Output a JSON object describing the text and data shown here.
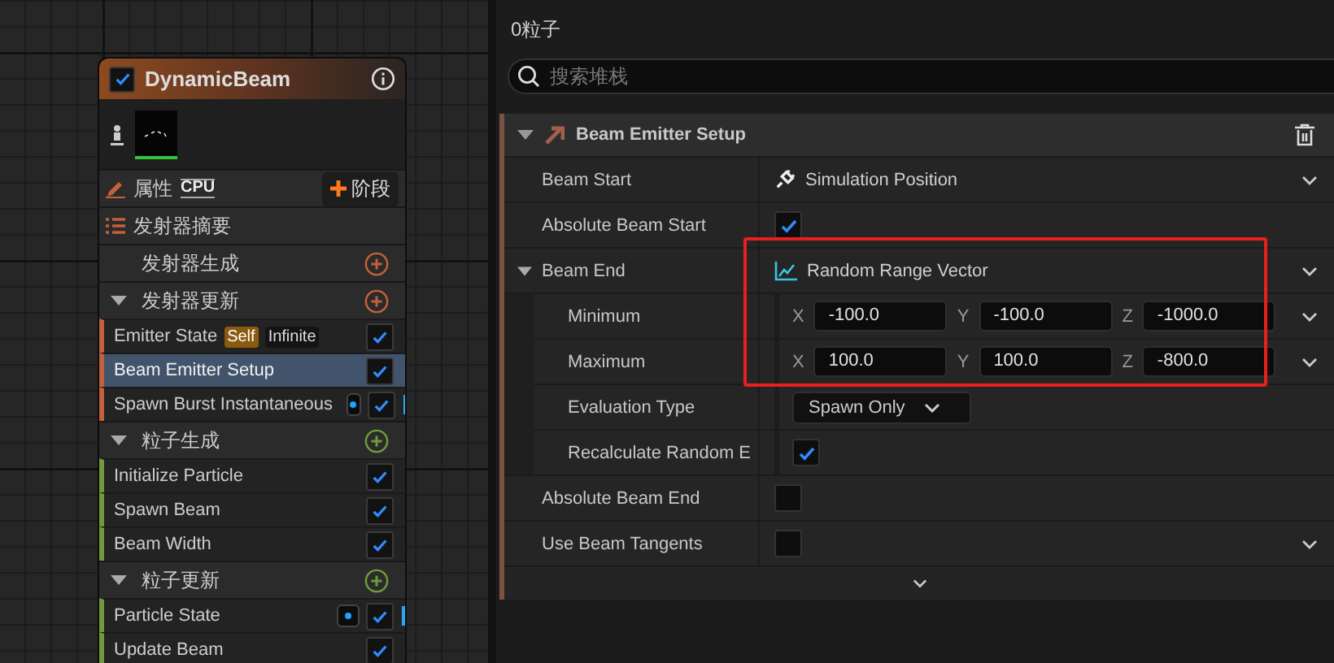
{
  "node": {
    "title": "DynamicBeam",
    "enabled": true,
    "properties_label": "属性",
    "sim_target": "CPU",
    "add_stage": "阶段",
    "summary": "发射器摘要",
    "groups": [
      {
        "title": "发射器生成",
        "color": "#c2613c"
      },
      {
        "title": "发射器更新",
        "color": "#c2613c",
        "modules": [
          {
            "label": "Emitter State",
            "enabled": true,
            "selected": false,
            "indicator": false,
            "badges": [
              {
                "text": "Self",
                "kind": "owner"
              },
              {
                "text": "Infinite",
                "kind": "plain"
              }
            ]
          },
          {
            "label": "Beam Emitter Setup",
            "enabled": true,
            "selected": true,
            "indicator": false
          },
          {
            "label": "Spawn Burst Instantaneous",
            "enabled": true,
            "selected": false,
            "indicator": true
          }
        ]
      },
      {
        "title": "粒子生成",
        "color": "#6f9b3c",
        "modules": [
          {
            "label": "Initialize Particle",
            "enabled": true,
            "selected": false,
            "indicator": false
          },
          {
            "label": "Spawn Beam",
            "enabled": true,
            "selected": false,
            "indicator": false
          },
          {
            "label": "Beam Width",
            "enabled": true,
            "selected": false,
            "indicator": false
          }
        ]
      },
      {
        "title": "粒子更新",
        "color": "#6f9b3c",
        "modules": [
          {
            "label": "Particle State",
            "enabled": true,
            "selected": false,
            "indicator": true
          },
          {
            "label": "Update Beam",
            "enabled": true,
            "selected": false,
            "indicator": false
          }
        ]
      }
    ]
  },
  "panel": {
    "particle_count": "0粒子",
    "search": {
      "placeholder": "搜索堆栈"
    },
    "section": {
      "title": "Beam Emitter Setup",
      "expanded": true,
      "rows": [
        {
          "label": "Beam Start",
          "kind": "link",
          "value": "Simulation Position",
          "menu": true,
          "highlighted": false
        },
        {
          "label": "Absolute Beam Start",
          "kind": "checkbox",
          "checked": true,
          "menu": false,
          "highlighted": false
        },
        {
          "label": "Beam End",
          "kind": "function",
          "value": "Random Range Vector",
          "menu": true,
          "highlighted": true,
          "expanded": true,
          "children": [
            {
              "label": "Minimum",
              "kind": "vector",
              "menu": true,
              "components": [
                {
                  "axis": "X",
                  "value": "-100.0"
                },
                {
                  "axis": "Y",
                  "value": "-100.0"
                },
                {
                  "axis": "Z",
                  "value": "-1000.0"
                }
              ]
            },
            {
              "label": "Maximum",
              "kind": "vector",
              "menu": true,
              "components": [
                {
                  "axis": "X",
                  "value": "100.0"
                },
                {
                  "axis": "Y",
                  "value": "100.0"
                },
                {
                  "axis": "Z",
                  "value": "-800.0"
                }
              ]
            },
            {
              "label": "Evaluation Type",
              "kind": "select",
              "value": "Spawn Only",
              "menu": false
            },
            {
              "label": "Recalculate Random E",
              "kind": "checkbox",
              "checked": true,
              "menu": false
            }
          ]
        },
        {
          "label": "Absolute Beam End",
          "kind": "checkbox",
          "checked": false,
          "menu": false,
          "highlighted": false
        },
        {
          "label": "Use Beam Tangents",
          "kind": "checkbox",
          "checked": false,
          "menu": true,
          "highlighted": false
        }
      ]
    }
  }
}
